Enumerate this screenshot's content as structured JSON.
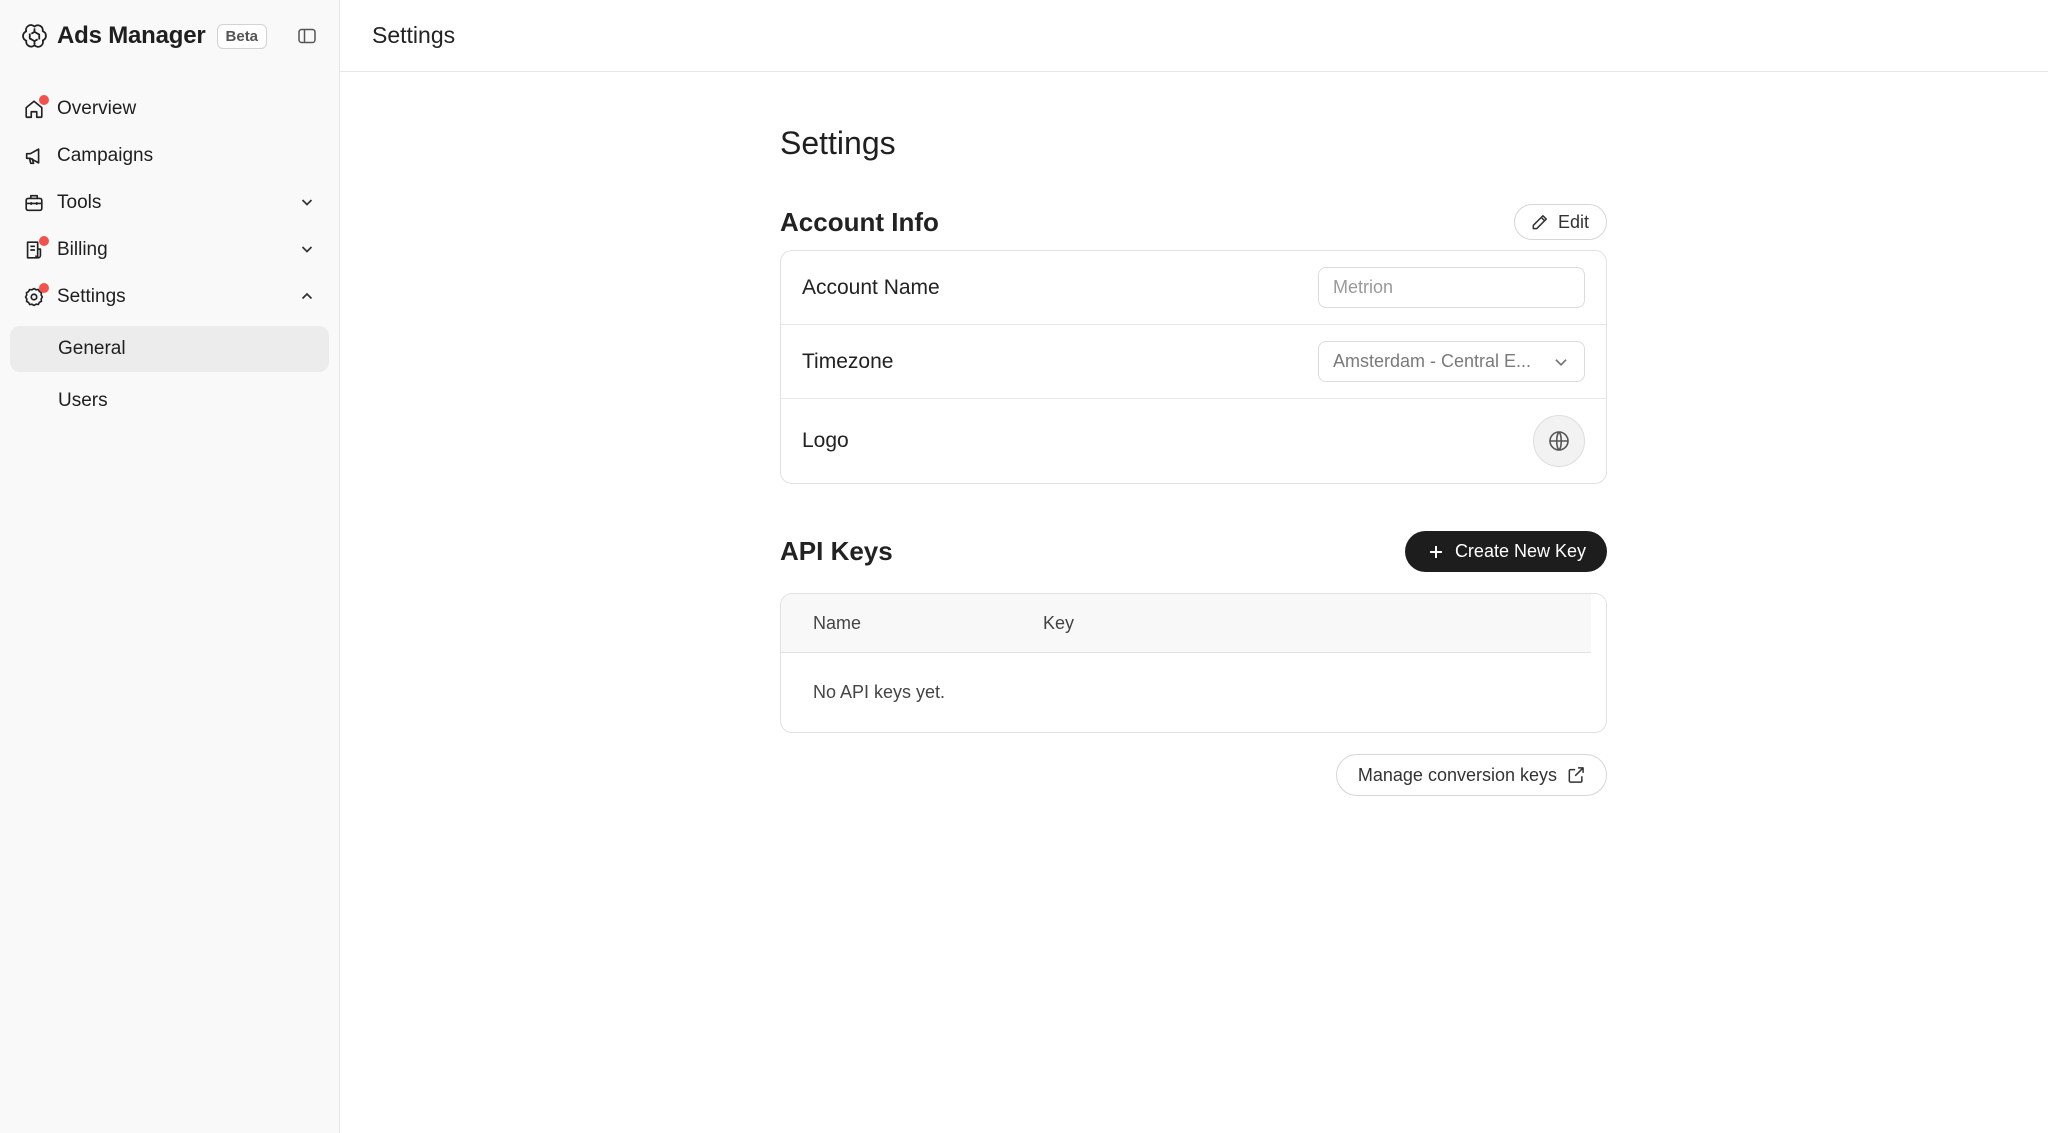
{
  "brand": {
    "name": "Ads Manager",
    "badge": "Beta"
  },
  "sidebar": {
    "items": [
      {
        "label": "Overview",
        "icon": "home-icon",
        "notification": true
      },
      {
        "label": "Campaigns",
        "icon": "megaphone-icon",
        "notification": false
      },
      {
        "label": "Tools",
        "icon": "toolbox-icon",
        "notification": false,
        "expanded": false
      },
      {
        "label": "Billing",
        "icon": "receipt-icon",
        "notification": true,
        "expanded": false
      },
      {
        "label": "Settings",
        "icon": "gear-icon",
        "notification": true,
        "expanded": true
      }
    ],
    "settings_sub": [
      {
        "label": "General",
        "active": true
      },
      {
        "label": "Users",
        "active": false
      }
    ]
  },
  "header": {
    "title": "Settings"
  },
  "main": {
    "title": "Settings",
    "account_info": {
      "title": "Account Info",
      "edit_label": "Edit",
      "rows": {
        "account_name": {
          "label": "Account Name",
          "placeholder": "Metrion"
        },
        "timezone": {
          "label": "Timezone",
          "value": "Amsterdam - Central E..."
        },
        "logo": {
          "label": "Logo",
          "icon": "globe-icon"
        }
      }
    },
    "api_keys": {
      "title": "API Keys",
      "create_label": "Create New Key",
      "columns": [
        "Name",
        "Key"
      ],
      "empty_text": "No API keys yet."
    },
    "manage_label": "Manage conversion keys"
  },
  "colors": {
    "notification": "#ef5350",
    "primary_button": "#1d1d1d",
    "sidebar_bg": "#f9f9f9"
  }
}
